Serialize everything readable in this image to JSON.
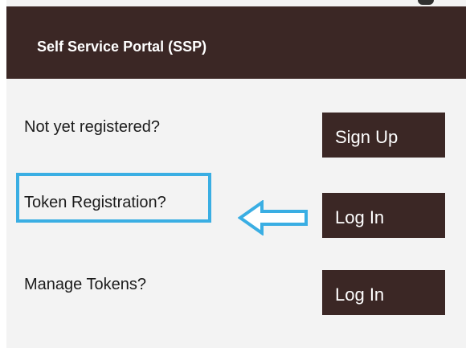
{
  "header": {
    "title": "Self Service Portal (SSP)"
  },
  "rows": [
    {
      "label": "Not yet registered?",
      "button": "Sign Up"
    },
    {
      "label": "Token Registration?",
      "button": "Log In"
    },
    {
      "label": "Manage Tokens?",
      "button": "Log In"
    }
  ],
  "colors": {
    "header_bg": "#3b2725",
    "button_bg": "#3b2725",
    "highlight": "#3aaee3",
    "panel_bg": "#f3f3f3"
  },
  "annotation": {
    "icon": "arrow-left-icon"
  }
}
